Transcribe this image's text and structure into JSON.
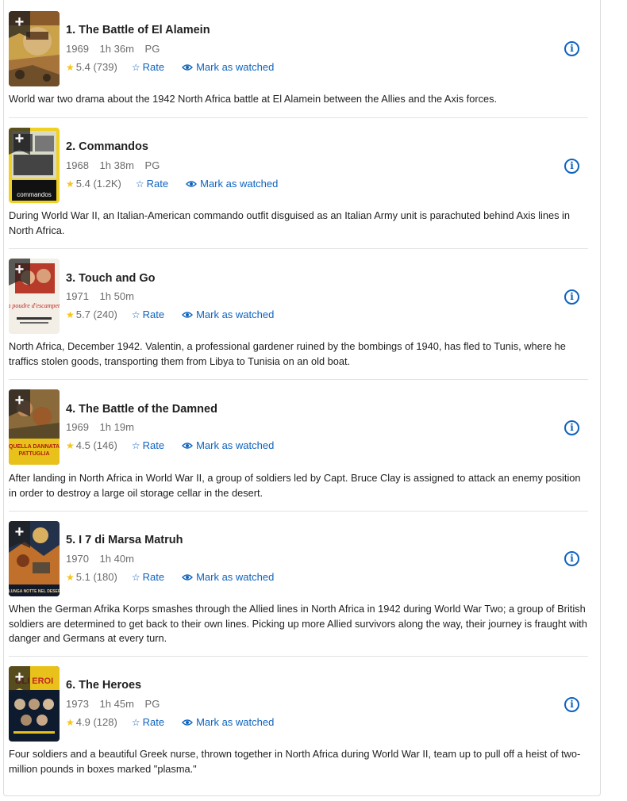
{
  "actions": {
    "rate_label": "Rate",
    "watch_label": "Mark as watched"
  },
  "colors": {
    "link": "#0e63be",
    "star": "#f5c518"
  },
  "movies": [
    {
      "title": "1. The Battle of El Alamein",
      "year": "1969",
      "runtime": "1h 36m",
      "cert": "PG",
      "rating": "5.4",
      "votes": "(739)",
      "description": "World war two drama about the 1942 North Africa battle at El Alamein between the Allies and the Axis forces."
    },
    {
      "title": "2. Commandos",
      "year": "1968",
      "runtime": "1h 38m",
      "cert": "PG",
      "rating": "5.4",
      "votes": "(1.2K)",
      "description": "During World War II, an Italian-American commando outfit disguised as an Italian Army unit is parachuted behind Axis lines in North Africa.",
      "poster_text": "commandos"
    },
    {
      "title": "3. Touch and Go",
      "year": "1971",
      "runtime": "1h 50m",
      "cert": "",
      "rating": "5.7",
      "votes": "(240)",
      "description": "North Africa, December 1942. Valentin, a professional gardener ruined by the bombings of 1940, has fled to Tunis, where he traffics stolen goods, transporting them from Libya to Tunisia on an old boat.",
      "poster_text": "La poudre d'escampette"
    },
    {
      "title": "4. The Battle of the Damned",
      "year": "1969",
      "runtime": "1h 19m",
      "cert": "",
      "rating": "4.5",
      "votes": "(146)",
      "description": "After landing in North Africa in World War II, a group of soldiers led by Capt. Bruce Clay is assigned to attack an enemy position in order to destroy a large oil storage cellar in the desert.",
      "poster_text": "QUELLA DANNATA PATTUGLIA"
    },
    {
      "title": "5. I 7 di Marsa Matruh",
      "year": "1970",
      "runtime": "1h 40m",
      "cert": "",
      "rating": "5.1",
      "votes": "(180)",
      "description": "When the German Afrika Korps smashes through the Allied lines in North Africa in 1942 during World War Two; a group of British soldiers are determined to get back to their own lines. Picking up more Allied survivors along the way, their journey is fraught with danger and Germans at every turn.",
      "poster_text": "LA LUNGA NOTTE NEL DESERTO"
    },
    {
      "title": "6. The Heroes",
      "year": "1973",
      "runtime": "1h 45m",
      "cert": "PG",
      "rating": "4.9",
      "votes": "(128)",
      "description": "Four soldiers and a beautiful Greek nurse, thrown together in North Africa during World War II, team up to pull off a heist of two-million pounds in boxes marked \"plasma.\"",
      "poster_text": "GLI EROI"
    }
  ]
}
